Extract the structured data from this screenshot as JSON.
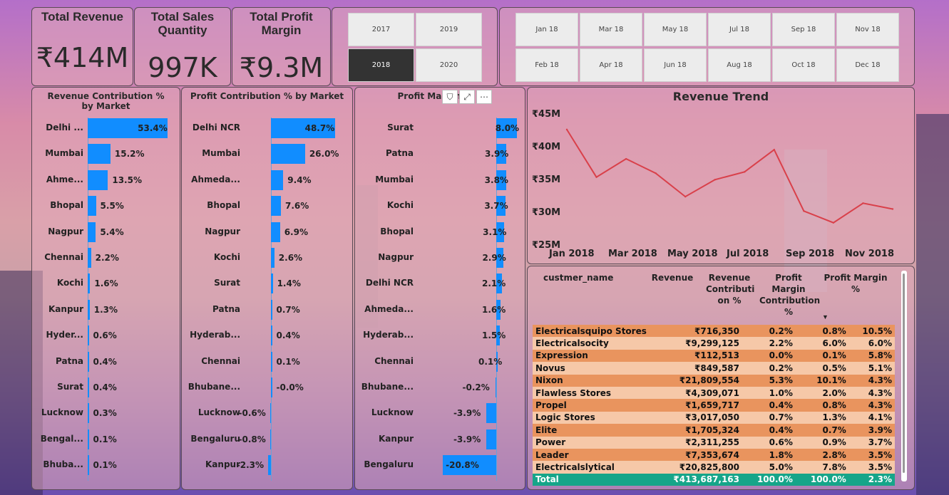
{
  "kpis": [
    {
      "title": "Total Revenue",
      "value": "₹414M"
    },
    {
      "title": "Total Sales Quantity",
      "value": "997K"
    },
    {
      "title": "Total Profit Margin",
      "value": "₹9.3M"
    }
  ],
  "year_slicer": {
    "options": [
      "2017",
      "2019",
      "2018",
      "2020"
    ],
    "selected": "2018"
  },
  "month_slicer": {
    "options": [
      "Jan 18",
      "Mar 18",
      "May 18",
      "Jul 18",
      "Sep 18",
      "Nov 18",
      "Feb 18",
      "Apr 18",
      "Jun 18",
      "Aug 18",
      "Oct 18",
      "Dec 18"
    ]
  },
  "visual_header_icons": [
    "filter-icon",
    "focus-mode-icon",
    "more-options-icon"
  ],
  "chart_data": [
    {
      "type": "bar",
      "title": "Revenue Contribution % by Market",
      "categories": [
        "Delhi ...",
        "Mumbai",
        "Ahme...",
        "Bhopal",
        "Nagpur",
        "Chennai",
        "Kochi",
        "Kanpur",
        "Hyder...",
        "Patna",
        "Surat",
        "Lucknow",
        "Bengal...",
        "Bhuba..."
      ],
      "values": [
        53.4,
        15.2,
        13.5,
        5.5,
        5.4,
        2.2,
        1.6,
        1.3,
        0.6,
        0.4,
        0.4,
        0.3,
        0.1,
        0.1
      ],
      "labels": [
        "53.4%",
        "15.2%",
        "13.5%",
        "5.5%",
        "5.4%",
        "2.2%",
        "1.6%",
        "1.3%",
        "0.6%",
        "0.4%",
        "0.4%",
        "0.3%",
        "0.1%",
        "0.1%"
      ],
      "color": "#118dff"
    },
    {
      "type": "bar",
      "title": "Profit Contribution % by Market",
      "categories": [
        "Delhi NCR",
        "Mumbai",
        "Ahmeda...",
        "Bhopal",
        "Nagpur",
        "Kochi",
        "Surat",
        "Patna",
        "Hyderab...",
        "Chennai",
        "Bhubane...",
        "Lucknow",
        "Bengaluru",
        "Kanpur"
      ],
      "values": [
        48.7,
        26.0,
        9.4,
        7.6,
        6.9,
        2.6,
        1.4,
        0.7,
        0.4,
        0.1,
        -0.0,
        -0.6,
        -0.8,
        -2.3
      ],
      "labels": [
        "48.7%",
        "26.0%",
        "9.4%",
        "7.6%",
        "6.9%",
        "2.6%",
        "1.4%",
        "0.7%",
        "0.4%",
        "0.1%",
        "-0.0%",
        "-0.6%",
        "-0.8%",
        "-2.3%"
      ],
      "color": "#118dff"
    },
    {
      "type": "bar",
      "title": "Profit Margin",
      "categories": [
        "Surat",
        "Patna",
        "Mumbai",
        "Kochi",
        "Bhopal",
        "Nagpur",
        "Delhi NCR",
        "Ahmeda...",
        "Hyderab...",
        "Chennai",
        "Bhubane...",
        "Lucknow",
        "Kanpur",
        "Bengaluru"
      ],
      "values": [
        8.0,
        3.9,
        3.8,
        3.7,
        3.1,
        2.9,
        2.1,
        1.6,
        1.5,
        0.1,
        -0.2,
        -3.9,
        -3.9,
        -20.8
      ],
      "labels": [
        "8.0%",
        "3.9%",
        "3.8%",
        "3.7%",
        "3.1%",
        "2.9%",
        "2.1%",
        "1.6%",
        "1.5%",
        "0.1%",
        "-0.2%",
        "-3.9%",
        "-3.9%",
        "-20.8%"
      ],
      "color": "#118dff"
    },
    {
      "type": "line",
      "title": "Revenue Trend",
      "x": [
        "Jan 2018",
        "Feb 2018",
        "Mar 2018",
        "Apr 2018",
        "May 2018",
        "Jun 2018",
        "Jul 2018",
        "Aug 2018",
        "Sep 2018",
        "Oct 2018",
        "Nov 2018",
        "Dec 2018"
      ],
      "x_tick_labels": [
        "Jan 2018",
        "Mar 2018",
        "May 2018",
        "Jul 2018",
        "Sep 2018",
        "Nov 2018"
      ],
      "series": [
        {
          "values": [
            42.5,
            35.2,
            38.0,
            35.8,
            32.2,
            34.8,
            36.0,
            39.4,
            30.0,
            28.2,
            31.2,
            30.3
          ]
        }
      ],
      "y_tick_labels": [
        "₹45M",
        "₹40M",
        "₹35M",
        "₹30M",
        "₹25M"
      ],
      "ylim": [
        25,
        45
      ],
      "color": "#d9404a",
      "grid": false
    }
  ],
  "table": {
    "columns": [
      "custmer_name",
      "Revenue",
      "Revenue Contributi on %",
      "Profit Margin Contribution %",
      "Profit Margin %"
    ],
    "sort_indicator": "▼",
    "rows": [
      [
        "Electricalsquipo Stores",
        "₹716,350",
        "0.2%",
        "0.8%",
        "10.5%"
      ],
      [
        "Electricalsocity",
        "₹9,299,125",
        "2.2%",
        "6.0%",
        "6.0%"
      ],
      [
        "Expression",
        "₹112,513",
        "0.0%",
        "0.1%",
        "5.8%"
      ],
      [
        "Novus",
        "₹849,587",
        "0.2%",
        "0.5%",
        "5.1%"
      ],
      [
        "Nixon",
        "₹21,809,554",
        "5.3%",
        "10.1%",
        "4.3%"
      ],
      [
        "Flawless Stores",
        "₹4,309,071",
        "1.0%",
        "2.0%",
        "4.3%"
      ],
      [
        "Propel",
        "₹1,659,717",
        "0.4%",
        "0.8%",
        "4.3%"
      ],
      [
        "Logic Stores",
        "₹3,017,050",
        "0.7%",
        "1.3%",
        "4.1%"
      ],
      [
        "Elite",
        "₹1,705,324",
        "0.4%",
        "0.7%",
        "3.9%"
      ],
      [
        "Power",
        "₹2,311,255",
        "0.6%",
        "0.9%",
        "3.7%"
      ],
      [
        "Leader",
        "₹7,353,674",
        "1.8%",
        "2.8%",
        "3.5%"
      ],
      [
        "Electricalslytical",
        "₹20,825,800",
        "5.0%",
        "7.8%",
        "3.5%"
      ]
    ],
    "total": [
      "Total",
      "₹413,687,163",
      "100.0%",
      "100.0%",
      "2.3%"
    ],
    "colors": {
      "row_dark": "#e9945e",
      "row_light": "#f6c8a8",
      "total_bg": "#16a589"
    }
  }
}
